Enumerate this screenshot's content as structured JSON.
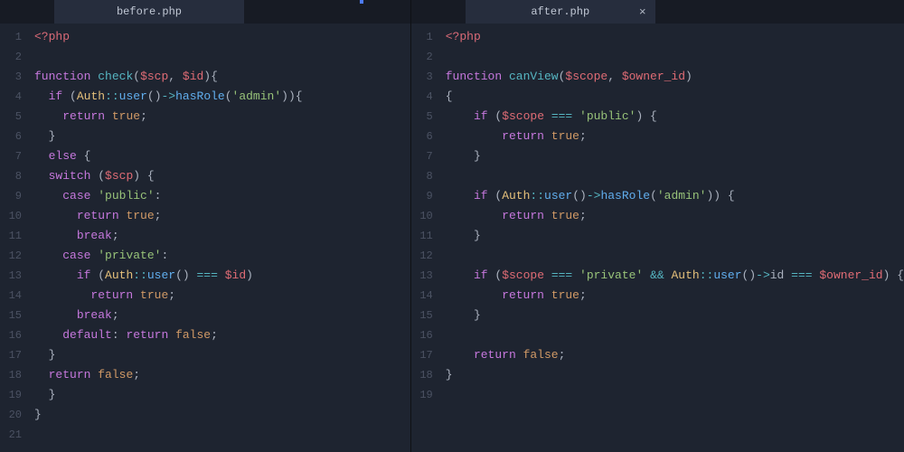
{
  "tabs": {
    "left": {
      "filename": "before.php",
      "closeable": false
    },
    "right": {
      "filename": "after.php",
      "closeable": true,
      "close_glyph": "×"
    }
  },
  "left_code": [
    [
      [
        "tag",
        "<?php"
      ]
    ],
    [],
    [
      [
        "kw",
        "function"
      ],
      [
        "plain",
        " "
      ],
      [
        "func",
        "check"
      ],
      [
        "punc",
        "("
      ],
      [
        "var",
        "$scp"
      ],
      [
        "punc",
        ", "
      ],
      [
        "var",
        "$id"
      ],
      [
        "punc",
        "){"
      ]
    ],
    [
      [
        "plain",
        "  "
      ],
      [
        "kw",
        "if"
      ],
      [
        "plain",
        " "
      ],
      [
        "punc",
        "("
      ],
      [
        "class",
        "Auth"
      ],
      [
        "op",
        "::"
      ],
      [
        "method",
        "user"
      ],
      [
        "punc",
        "()"
      ],
      [
        "op",
        "->"
      ],
      [
        "method",
        "hasRole"
      ],
      [
        "punc",
        "("
      ],
      [
        "str",
        "'admin'"
      ],
      [
        "punc",
        ")){"
      ]
    ],
    [
      [
        "plain",
        "    "
      ],
      [
        "kw",
        "return"
      ],
      [
        "plain",
        " "
      ],
      [
        "bool",
        "true"
      ],
      [
        "punc",
        ";"
      ]
    ],
    [
      [
        "plain",
        "  "
      ],
      [
        "punc",
        "}"
      ]
    ],
    [
      [
        "plain",
        "  "
      ],
      [
        "kw",
        "else"
      ],
      [
        "plain",
        " "
      ],
      [
        "punc",
        "{"
      ]
    ],
    [
      [
        "plain",
        "  "
      ],
      [
        "kw",
        "switch"
      ],
      [
        "plain",
        " "
      ],
      [
        "punc",
        "("
      ],
      [
        "var",
        "$scp"
      ],
      [
        "punc",
        ") {"
      ]
    ],
    [
      [
        "plain",
        "    "
      ],
      [
        "kw",
        "case"
      ],
      [
        "plain",
        " "
      ],
      [
        "str",
        "'public'"
      ],
      [
        "punc",
        ":"
      ]
    ],
    [
      [
        "plain",
        "      "
      ],
      [
        "kw",
        "return"
      ],
      [
        "plain",
        " "
      ],
      [
        "bool",
        "true"
      ],
      [
        "punc",
        ";"
      ]
    ],
    [
      [
        "plain",
        "      "
      ],
      [
        "kw",
        "break"
      ],
      [
        "punc",
        ";"
      ]
    ],
    [
      [
        "plain",
        "    "
      ],
      [
        "kw",
        "case"
      ],
      [
        "plain",
        " "
      ],
      [
        "str",
        "'private'"
      ],
      [
        "punc",
        ":"
      ]
    ],
    [
      [
        "plain",
        "      "
      ],
      [
        "kw",
        "if"
      ],
      [
        "plain",
        " "
      ],
      [
        "punc",
        "("
      ],
      [
        "class",
        "Auth"
      ],
      [
        "op",
        "::"
      ],
      [
        "method",
        "user"
      ],
      [
        "punc",
        "() "
      ],
      [
        "op",
        "==="
      ],
      [
        "plain",
        " "
      ],
      [
        "var",
        "$id"
      ],
      [
        "punc",
        ")"
      ]
    ],
    [
      [
        "plain",
        "        "
      ],
      [
        "kw",
        "return"
      ],
      [
        "plain",
        " "
      ],
      [
        "bool",
        "true"
      ],
      [
        "punc",
        ";"
      ]
    ],
    [
      [
        "plain",
        "      "
      ],
      [
        "kw",
        "break"
      ],
      [
        "punc",
        ";"
      ]
    ],
    [
      [
        "plain",
        "    "
      ],
      [
        "kw",
        "default"
      ],
      [
        "punc",
        ": "
      ],
      [
        "kw",
        "return"
      ],
      [
        "plain",
        " "
      ],
      [
        "bool",
        "false"
      ],
      [
        "punc",
        ";"
      ]
    ],
    [
      [
        "plain",
        "  "
      ],
      [
        "punc",
        "}"
      ]
    ],
    [
      [
        "plain",
        "  "
      ],
      [
        "kw",
        "return"
      ],
      [
        "plain",
        " "
      ],
      [
        "bool",
        "false"
      ],
      [
        "punc",
        ";"
      ]
    ],
    [
      [
        "plain",
        "  "
      ],
      [
        "punc",
        "}"
      ]
    ],
    [
      [
        "punc",
        "}"
      ]
    ],
    []
  ],
  "right_code": [
    [
      [
        "tag",
        "<?php"
      ]
    ],
    [],
    [
      [
        "kw",
        "function"
      ],
      [
        "plain",
        " "
      ],
      [
        "func",
        "canView"
      ],
      [
        "punc",
        "("
      ],
      [
        "var",
        "$scope"
      ],
      [
        "punc",
        ", "
      ],
      [
        "var",
        "$owner_id"
      ],
      [
        "punc",
        ")"
      ]
    ],
    [
      [
        "punc",
        "{"
      ]
    ],
    [
      [
        "plain",
        "    "
      ],
      [
        "kw",
        "if"
      ],
      [
        "plain",
        " "
      ],
      [
        "punc",
        "("
      ],
      [
        "var",
        "$scope"
      ],
      [
        "plain",
        " "
      ],
      [
        "op",
        "==="
      ],
      [
        "plain",
        " "
      ],
      [
        "str",
        "'public'"
      ],
      [
        "punc",
        ") {"
      ]
    ],
    [
      [
        "plain",
        "        "
      ],
      [
        "kw",
        "return"
      ],
      [
        "plain",
        " "
      ],
      [
        "bool",
        "true"
      ],
      [
        "punc",
        ";"
      ]
    ],
    [
      [
        "plain",
        "    "
      ],
      [
        "punc",
        "}"
      ]
    ],
    [],
    [
      [
        "plain",
        "    "
      ],
      [
        "kw",
        "if"
      ],
      [
        "plain",
        " "
      ],
      [
        "punc",
        "("
      ],
      [
        "class",
        "Auth"
      ],
      [
        "op",
        "::"
      ],
      [
        "method",
        "user"
      ],
      [
        "punc",
        "()"
      ],
      [
        "op",
        "->"
      ],
      [
        "method",
        "hasRole"
      ],
      [
        "punc",
        "("
      ],
      [
        "str",
        "'admin'"
      ],
      [
        "punc",
        ")) {"
      ]
    ],
    [
      [
        "plain",
        "        "
      ],
      [
        "kw",
        "return"
      ],
      [
        "plain",
        " "
      ],
      [
        "bool",
        "true"
      ],
      [
        "punc",
        ";"
      ]
    ],
    [
      [
        "plain",
        "    "
      ],
      [
        "punc",
        "}"
      ]
    ],
    [],
    [
      [
        "plain",
        "    "
      ],
      [
        "kw",
        "if"
      ],
      [
        "plain",
        " "
      ],
      [
        "punc",
        "("
      ],
      [
        "var",
        "$scope"
      ],
      [
        "plain",
        " "
      ],
      [
        "op",
        "==="
      ],
      [
        "plain",
        " "
      ],
      [
        "str",
        "'private'"
      ],
      [
        "plain",
        " "
      ],
      [
        "op",
        "&&"
      ],
      [
        "plain",
        " "
      ],
      [
        "class",
        "Auth"
      ],
      [
        "op",
        "::"
      ],
      [
        "method",
        "user"
      ],
      [
        "punc",
        "()"
      ],
      [
        "op",
        "->"
      ],
      [
        "plain",
        "id "
      ],
      [
        "op",
        "==="
      ],
      [
        "plain",
        " "
      ],
      [
        "var",
        "$owner_id"
      ],
      [
        "punc",
        ") {"
      ]
    ],
    [
      [
        "plain",
        "        "
      ],
      [
        "kw",
        "return"
      ],
      [
        "plain",
        " "
      ],
      [
        "bool",
        "true"
      ],
      [
        "punc",
        ";"
      ]
    ],
    [
      [
        "plain",
        "    "
      ],
      [
        "punc",
        "}"
      ]
    ],
    [],
    [
      [
        "plain",
        "    "
      ],
      [
        "kw",
        "return"
      ],
      [
        "plain",
        " "
      ],
      [
        "bool",
        "false"
      ],
      [
        "punc",
        ";"
      ]
    ],
    [
      [
        "punc",
        "}"
      ]
    ],
    []
  ]
}
